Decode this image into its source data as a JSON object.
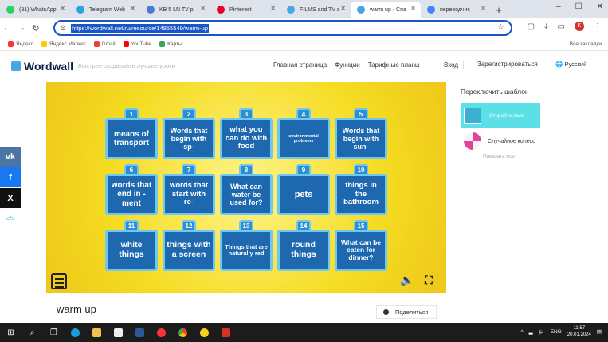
{
  "browser": {
    "tabs": [
      {
        "label": "(31) WhatsApp",
        "color": "#25d366",
        "active": false
      },
      {
        "label": "Telegram Web",
        "color": "#2aa3de",
        "active": false
      },
      {
        "label": "KB 5 LN TV pl",
        "color": "#4a7bd0",
        "active": false
      },
      {
        "label": "Pinterest",
        "color": "#e60023",
        "active": false
      },
      {
        "label": "FILMS and TV s",
        "color": "#46a5e5",
        "active": false
      },
      {
        "label": "warm up - Спа",
        "color": "#46a5e5",
        "active": true
      },
      {
        "label": "переводчик",
        "color": "#4285f4",
        "active": false
      }
    ],
    "new_tab": "+",
    "url": "https://wordwall.net/ru/resource/14855549/warm-up"
  },
  "bookmarks": [
    {
      "label": "Яндекс",
      "color": "#f33"
    },
    {
      "label": "Яндекс Маркет",
      "color": "#fc0"
    },
    {
      "label": "Gmail",
      "color": "#ea4335"
    },
    {
      "label": "YouTube",
      "color": "#f00"
    },
    {
      "label": "Карты",
      "color": "#34a853"
    }
  ],
  "bookmarks_right": "Все закладки",
  "site": {
    "logo": "Wordwall",
    "tagline": "Быстрее создавайте лучшие уроки",
    "nav": [
      "Главная страница",
      "Функции",
      "Тарифные планы"
    ],
    "login": "Вход",
    "register": "Зарегистрироваться",
    "language": "Русский"
  },
  "share_sidebar": [
    {
      "name": "vk",
      "glyph": "vk",
      "color": "#4c75a3"
    },
    {
      "name": "facebook",
      "glyph": "f",
      "color": "#1877f2"
    },
    {
      "name": "x",
      "glyph": "X",
      "color": "#111"
    },
    {
      "name": "embed",
      "glyph": "</>",
      "color": "#6ec6e6"
    }
  ],
  "activity": {
    "cards": [
      {
        "num": "1",
        "text": "means of transport",
        "size": 10
      },
      {
        "num": "2",
        "text": "Words that begin with sp-",
        "size": 9
      },
      {
        "num": "3",
        "text": "what you can do with food",
        "size": 9.5
      },
      {
        "num": "4",
        "text": "environmental problems",
        "size": 5.5
      },
      {
        "num": "5",
        "text": "Words that begin with sun-",
        "size": 9
      },
      {
        "num": "6",
        "text": "words that end in -ment",
        "size": 10
      },
      {
        "num": "7",
        "text": "words that start with re-",
        "size": 9.5
      },
      {
        "num": "8",
        "text": "What can water be used for?",
        "size": 9
      },
      {
        "num": "9",
        "text": "pets",
        "size": 11
      },
      {
        "num": "10",
        "text": "things in the bathroom",
        "size": 9.5
      },
      {
        "num": "11",
        "text": "white things",
        "size": 10.5
      },
      {
        "num": "12",
        "text": "things with a screen",
        "size": 10.5
      },
      {
        "num": "13",
        "text": "Things that are naturally red",
        "size": 7.5
      },
      {
        "num": "14",
        "text": "round things",
        "size": 10.5
      },
      {
        "num": "15",
        "text": "What can be eaten for dinner?",
        "size": 8.5
      }
    ]
  },
  "right_panel": {
    "title": "Переключить шаблон",
    "active_template": "Откройте поле",
    "other_template": "Случайное колесо",
    "show_all": "Показать все"
  },
  "page": {
    "title": "warm up",
    "share": "Поделиться"
  },
  "taskbar": {
    "language": "ENG",
    "time": "11:57",
    "date": "20.01.2024"
  }
}
